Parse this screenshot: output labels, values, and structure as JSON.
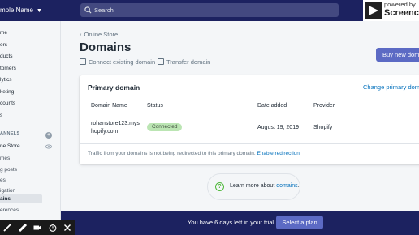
{
  "header": {
    "store_name": "mple Name",
    "search_placeholder": "Search",
    "powered_by": "powered by",
    "recorder_brand": "Screenc"
  },
  "sidebar": {
    "items": [
      {
        "label": "me"
      },
      {
        "label": "ers"
      },
      {
        "label": "ducts"
      },
      {
        "label": "tomers"
      },
      {
        "label": "lytics"
      },
      {
        "label": "keting"
      },
      {
        "label": "counts"
      },
      {
        "label": "s"
      }
    ],
    "channels_heading": "ANNELS",
    "channel": "ne Store",
    "sub_items": [
      {
        "label": "mes"
      },
      {
        "label": "g posts"
      },
      {
        "label": "es"
      },
      {
        "label": "igation"
      },
      {
        "label": "ains",
        "active": true
      },
      {
        "label": "erences"
      }
    ]
  },
  "page": {
    "breadcrumb": "Online Store",
    "title": "Domains",
    "connect_label": "Connect existing domain",
    "transfer_label": "Transfer domain",
    "buy_button": "Buy new domain"
  },
  "card": {
    "title": "Primary domain",
    "change_link": "Change primary domain",
    "columns": [
      "Domain Name",
      "Status",
      "Date added",
      "Provider"
    ],
    "row": {
      "domain_line1": "rohanstore123.mys",
      "domain_line2": "hopify.com",
      "status": "Connected",
      "date_added": "August 19, 2019",
      "provider": "Shopify"
    },
    "footer_text": "Traffic from your domains is not being redirected to this primary domain.",
    "footer_link": "Enable redirection"
  },
  "learn_more": {
    "text": "Learn more about",
    "link": "domains",
    "suffix": "."
  },
  "trial": {
    "text": "You have 6 days left in your trial",
    "button": "Select a plan"
  },
  "colors": {
    "topbar": "#1c2260",
    "accent": "#5c6ac4",
    "link": "#006fbb",
    "success_badge": "#bbe5b3"
  }
}
